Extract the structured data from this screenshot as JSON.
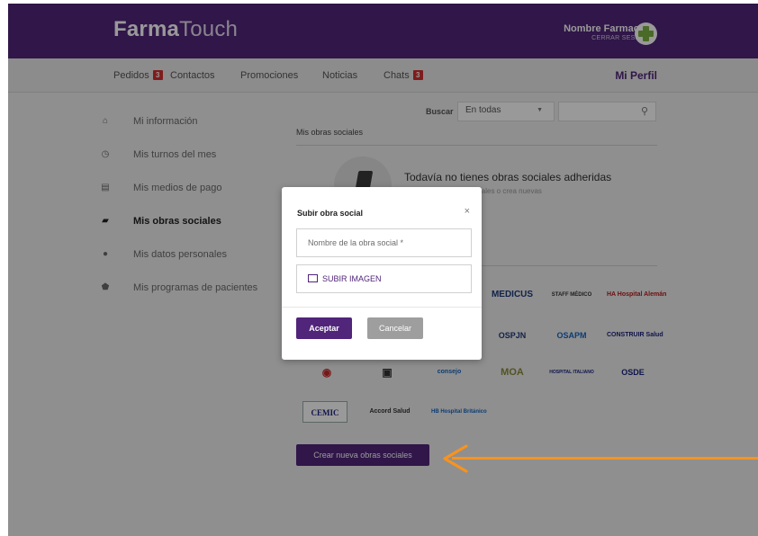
{
  "header": {
    "logo_bold": "Farma",
    "logo_light": "Touch",
    "pharmacy_name": "Nombre Farmacia",
    "logout": "CERRAR SESIÓN"
  },
  "nav": {
    "orders": "Pedidos",
    "orders_badge": "3",
    "contacts": "Contactos",
    "promotions": "Promociones",
    "news": "Noticias",
    "chats": "Chats",
    "chats_badge": "3",
    "profile": "Mi Perfil"
  },
  "sidebar": {
    "items": [
      {
        "label": "Mi información",
        "icon": "home-icon"
      },
      {
        "label": "Mis turnos del mes",
        "icon": "clock-icon"
      },
      {
        "label": "Mis medios de pago",
        "icon": "credit-card-icon"
      },
      {
        "label": "Mis obras sociales",
        "icon": "book-icon"
      },
      {
        "label": "Mis datos personales",
        "icon": "user-icon"
      },
      {
        "label": "Mis programas de pacientes",
        "icon": "shield-icon"
      }
    ]
  },
  "main": {
    "search_label": "Buscar",
    "search_select": "En todas",
    "section_title": "Mis obras sociales",
    "empty_title": "Todavía no tienes obras sociales adheridas",
    "empty_sub": "ciales o crea nuevas",
    "logos": [
      "MEDICUS",
      "STAFF MÉDICO",
      "HA Hospital Alemán",
      "OSPJN",
      "OSAPM",
      "CONSTRUIR Salud",
      "consejo",
      "MOA",
      "HOSPITAL ITALIANO",
      "OSDE",
      "CEMIC",
      "Accord Salud",
      "HB Hospital Británico"
    ],
    "create_button": "Crear nueva obras sociales"
  },
  "modal": {
    "title": "Subir obra social",
    "close": "×",
    "name_placeholder": "Nombre de la obra social *",
    "upload_label": "SUBIR IMAGEN",
    "accept": "Aceptar",
    "cancel": "Cancelar"
  },
  "colors": {
    "brand": "#50257a",
    "badge": "#d32f2f",
    "arrow": "#f7931e",
    "cross": "#7cb342"
  }
}
